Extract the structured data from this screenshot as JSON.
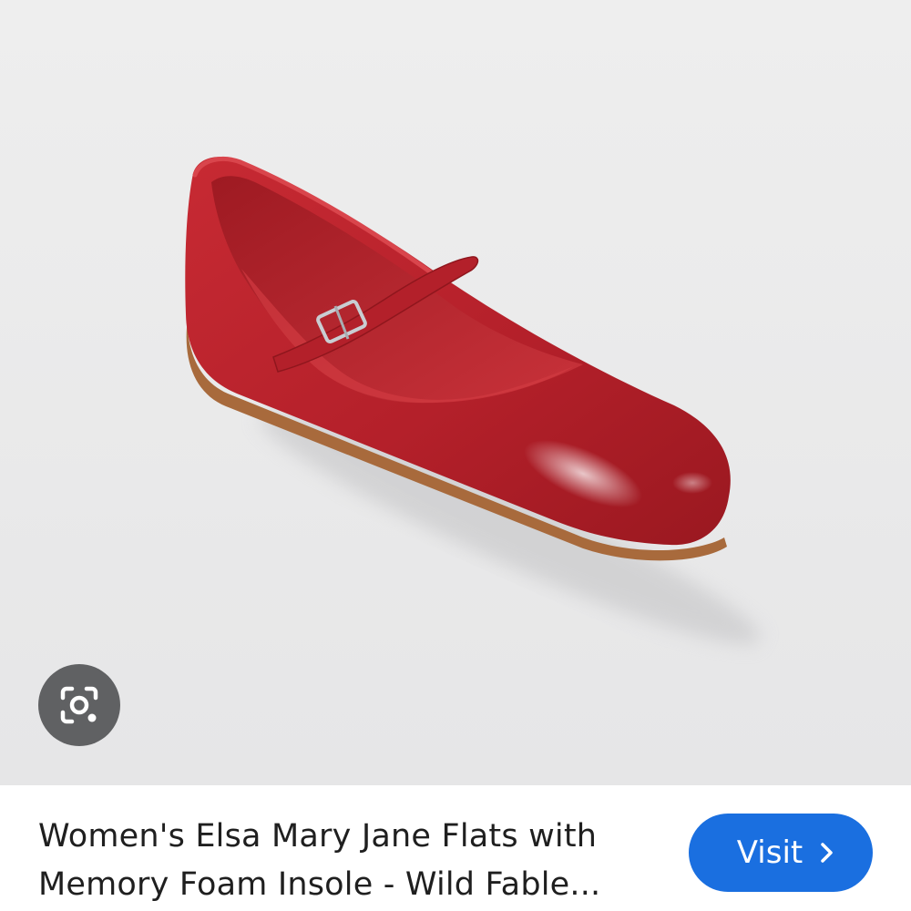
{
  "result_card": {
    "image": {
      "subject": "red mary jane flat shoe",
      "background_color": "#e9e9ea",
      "shoe_color": "#b8222b"
    },
    "lens_button": {
      "icon": "google-lens-icon",
      "color": "#606163"
    },
    "title": "Women's Elsa Mary Jane Flats with Memory Foam Insole - Wild Fable...",
    "visit_button": {
      "label": "Visit",
      "icon": "chevron-right-icon",
      "color": "#1a6fe0"
    }
  }
}
